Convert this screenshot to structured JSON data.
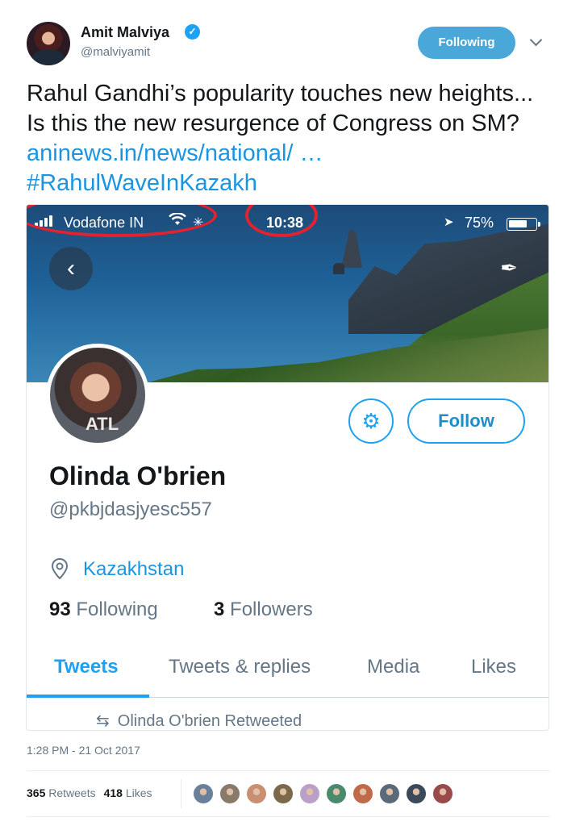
{
  "tweet": {
    "author_name": "Amit Malviya",
    "author_handle": "@malviyamit",
    "following_label": "Following",
    "text_main": "Rahul Gandhi’s popularity touches new heights... Is this the new resurgence of Congress on SM?",
    "text_link": "aninews.in/news/national/ …",
    "text_hashtag": "#RahulWaveInKazakh",
    "timestamp": "1:28 PM - 21 Oct 2017",
    "retweets_count": "365",
    "retweets_label": "Retweets",
    "likes_count": "418",
    "likes_label": "Likes",
    "likers": [
      "#6a7f9a",
      "#8a7a6a",
      "#c89070",
      "#7a6a4a",
      "#b8a0c8",
      "#4a8a6a",
      "#c06a4a",
      "#5a6a7a",
      "#3a4a5a",
      "#9a4a4a"
    ]
  },
  "embedded": {
    "status_bar": {
      "carrier": "Vodafone IN",
      "time": "10:38",
      "battery": "75%"
    },
    "profile": {
      "pic_text": "ATL",
      "name": "Olinda O'brien",
      "handle": "@pkbjdasjyesc557",
      "location": "Kazakhstan",
      "following_count": "93",
      "following_label": "Following",
      "followers_count": "3",
      "followers_label": "Followers",
      "follow_label": "Follow"
    },
    "tabs": [
      "Tweets",
      "Tweets & replies",
      "Media",
      "Likes"
    ],
    "retweeted_text": "Olinda O'brien Retweeted"
  },
  "colors": {
    "accent": "#1da1f2",
    "link": "#1b95e0",
    "highlight_ring": "#e0232e",
    "following_button": "#4aa8d8"
  },
  "icons": [
    "verified-icon",
    "chevron-down-icon",
    "signal-icon",
    "wifi-icon",
    "location-arrow-icon",
    "battery-icon",
    "back-arrow-icon",
    "compose-icon",
    "settings-gear-icon",
    "location-pin-icon",
    "retweet-icon"
  ]
}
